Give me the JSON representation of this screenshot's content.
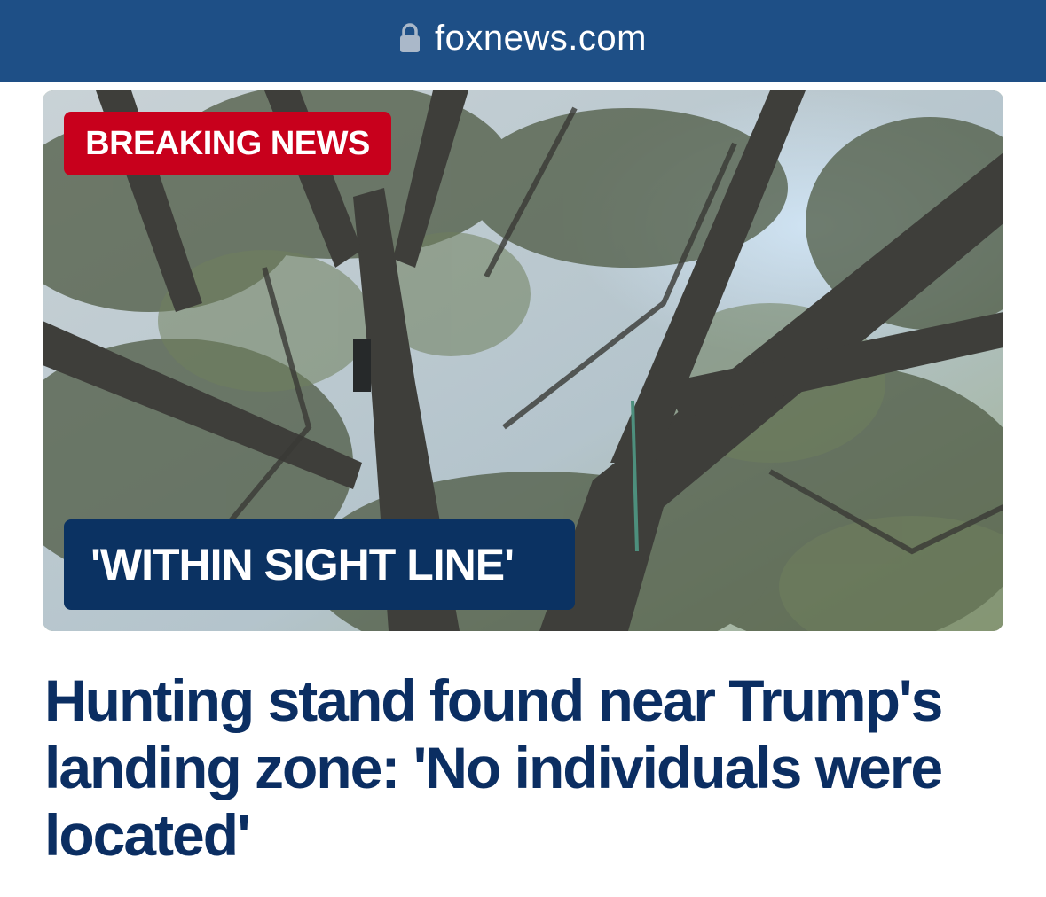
{
  "browser": {
    "url": "foxnews.com",
    "lock_icon": "lock-icon"
  },
  "hero": {
    "image_subject": "tree-canopy-photo",
    "breaking_badge": "BREAKING NEWS",
    "caption_badge": "'WITHIN SIGHT LINE'"
  },
  "article": {
    "headline": "Hunting stand found near Trump's landing zone: 'No individuals were located'"
  },
  "colors": {
    "url_bar": "#1e4f86",
    "breaking_red": "#c8001c",
    "caption_navy": "#0b3262",
    "headline_navy": "#0b2e62"
  }
}
